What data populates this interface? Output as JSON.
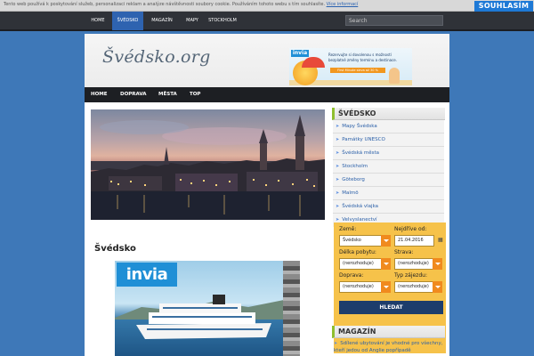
{
  "cookie_bar": {
    "text": "Tento web používá k poskytování služeb, personalizaci reklam a analýze návštěvnosti soubory cookie. Používáním tohoto webu s tím souhlasíte.",
    "link_label": "Více informací",
    "accept_label": "SOUHLASÍM"
  },
  "top_nav": {
    "items": [
      "HOME",
      "ŠVÉDSKO",
      "MAGAZÍN",
      "MAPY",
      "STOCKHOLM"
    ],
    "active": "ŠVÉDSKO",
    "search_placeholder": "Search"
  },
  "header": {
    "logo": "Švédsko.org",
    "ad": {
      "brand": "invia",
      "text": "Rezervujte si dovolenou s možností bezplatné změny termínu a destinace.",
      "button": "First Minute sleva až 30 %"
    }
  },
  "main_nav": {
    "items": [
      "HOME",
      "DOPRAVA",
      "MĚSTA",
      "TOP"
    ]
  },
  "content": {
    "title": "Švédsko",
    "ad_brand": "invia"
  },
  "sidebar": {
    "section_title": "ŠVÉDSKO",
    "items": [
      "Mapy Švédska",
      "Památky UNESCO",
      "Švédská města",
      "Stockholm",
      "Göteborg",
      "Malmö",
      "Švédská vlajka",
      "Velvyslanectví"
    ],
    "form": {
      "country_label": "Země:",
      "country_value": "Švédsko",
      "date_label": "Nejdříve od:",
      "date_value": "21.04.2016",
      "length_label": "Délka pobytu:",
      "length_value": "(nerozhoduje)",
      "board_label": "Strava:",
      "board_value": "(nerozhoduje)",
      "transport_label": "Doprava:",
      "transport_value": "(nerozhoduje)",
      "type_label": "Typ zájezdu:",
      "type_value": "(nerozhoduje)",
      "submit": "HLEDAT"
    },
    "magazine_title": "MAGAZÍN",
    "magazine_item": "Sdílené ubytování je vhodné pro všechny, kteří jedou od Anglie popřípadě"
  },
  "colors": {
    "background": "#3e78b8",
    "top_nav_bg": "#2f3238",
    "active_tab": "#2e63b0",
    "accept_button": "#1e79d6",
    "form_bg": "#f6c24a",
    "submit_button": "#1d3d6c",
    "sidebar_accent": "#8fbf2f"
  }
}
